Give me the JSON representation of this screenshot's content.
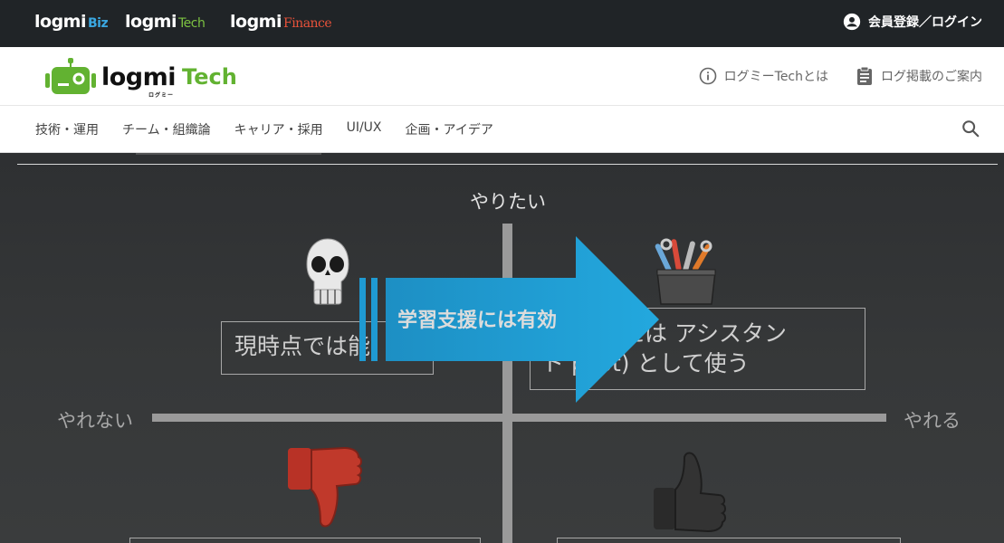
{
  "network_bar": {
    "brands": [
      {
        "name": "logmi",
        "suffix": "Biz"
      },
      {
        "name": "logmi",
        "suffix": "Tech"
      },
      {
        "name": "logmi",
        "suffix": "Finance"
      }
    ],
    "login_label": "会員登録／ログイン",
    "login_icon": "account-circle-icon"
  },
  "header": {
    "logo_word": "logmi",
    "logo_kana": "ログミー",
    "logo_tech": "Tech",
    "links": [
      {
        "label": "ログミーTechとは",
        "icon": "info-icon"
      },
      {
        "label": "ログ掲載のご案内",
        "icon": "clipboard-icon"
      }
    ]
  },
  "category_nav": {
    "items": [
      "技術・運用",
      "チーム・組織論",
      "キャリア・採用",
      "UI/UX",
      "企画・アイデア"
    ],
    "search_icon": "search-icon"
  },
  "slide": {
    "axis_top": "やりたい",
    "axis_left": "やれない",
    "axis_right": "やれる",
    "box_left_text": "現時点では能",
    "box_right_line1": "または アシスタン",
    "box_right_line2": "ト  pilot) として使う",
    "arrow_text": "学習支援には有効",
    "colors": {
      "arrow": "#1e9ed6",
      "thumbs_down": "#c0392b",
      "background": "#2e3032"
    }
  }
}
